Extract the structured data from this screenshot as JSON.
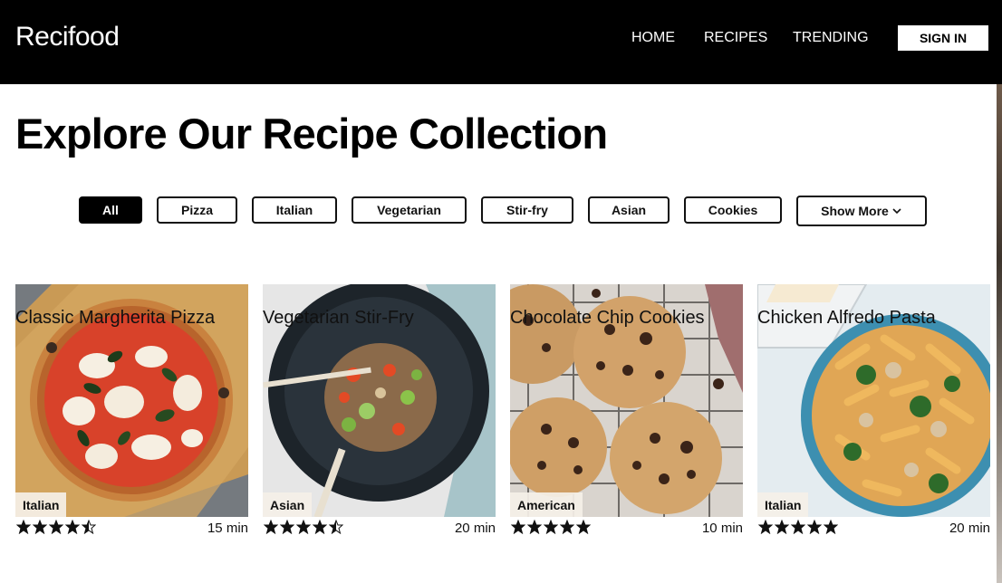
{
  "header": {
    "brand": "Recifood",
    "nav": [
      "HOME",
      "RECIPES",
      "TRENDING"
    ],
    "signin": "SIGN IN"
  },
  "page": {
    "title": "Explore Our Recipe Collection"
  },
  "filters": {
    "chips": [
      "All",
      "Pizza",
      "Italian",
      "Vegetarian",
      "Stir-fry",
      "Asian",
      "Cookies"
    ],
    "active": "All",
    "show_more": "Show More"
  },
  "recipes": [
    {
      "title": "Classic Margherita Pizza",
      "cuisine": "Italian",
      "time": "15 min",
      "rating": 4.5
    },
    {
      "title": "Vegetarian Stir-Fry",
      "cuisine": "Asian",
      "time": "20 min",
      "rating": 4.5
    },
    {
      "title": "Chocolate Chip Cookies",
      "cuisine": "American",
      "time": "10 min",
      "rating": 5
    },
    {
      "title": "Chicken Alfredo Pasta",
      "cuisine": "Italian",
      "time": "20 min",
      "rating": 5
    }
  ],
  "colors": {
    "header_bg": "#000000",
    "accent": "#000000",
    "text": "#111111"
  }
}
